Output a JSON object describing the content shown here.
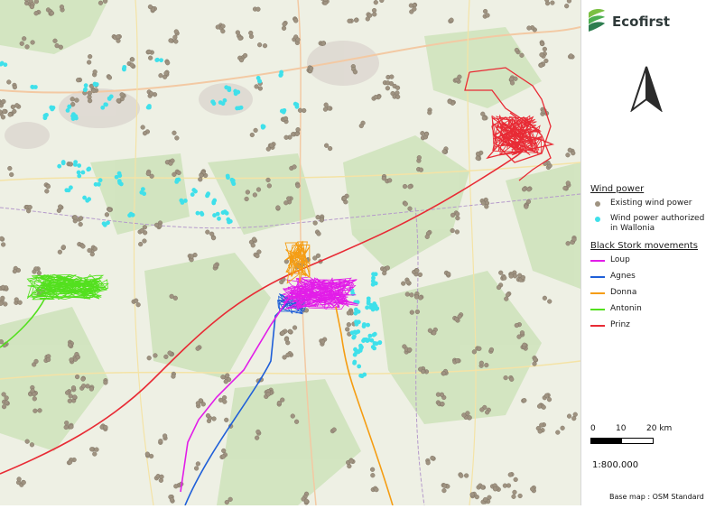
{
  "brand": {
    "name": "Ecofirst"
  },
  "legend": {
    "wind_heading": "Wind power",
    "wind_items": [
      {
        "label": "Existing wind power",
        "color": "#9f9381"
      },
      {
        "label": "Wind power authorized in Wallonia",
        "color": "#3fe0ea"
      }
    ],
    "storks_heading": "Black Stork movements",
    "storks": [
      {
        "label": "Loup",
        "color": "#e21de8"
      },
      {
        "label": "Agnes",
        "color": "#1f5fd8"
      },
      {
        "label": "Donna",
        "color": "#f59d13"
      },
      {
        "label": "Antonin",
        "color": "#53e01e"
      },
      {
        "label": "Prinz",
        "color": "#e82b35"
      }
    ]
  },
  "scale": {
    "ticks": [
      "0",
      "10",
      "20 km"
    ],
    "ratio": "1:800.000"
  },
  "basemap": "Base map : OSM Standard",
  "icons": {
    "north_arrow": "north-arrow-icon",
    "logo": "ecofirst-leaf-logo"
  }
}
